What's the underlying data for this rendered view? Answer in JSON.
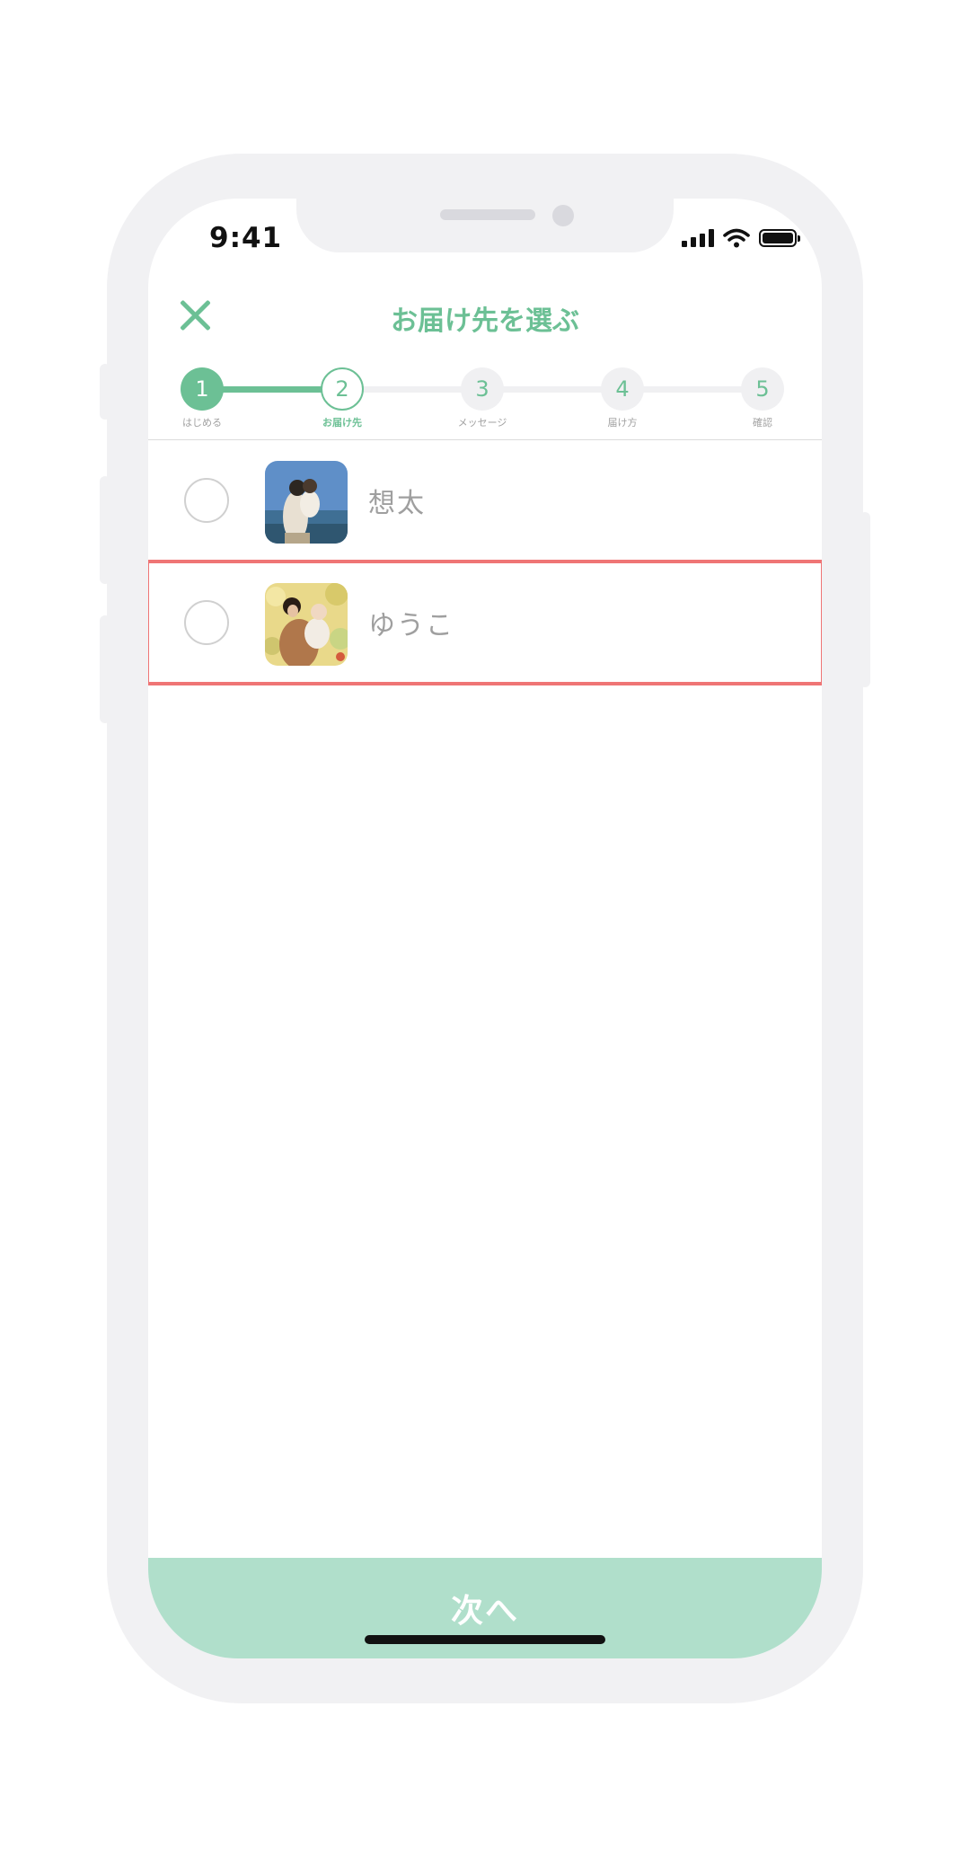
{
  "status_bar": {
    "time": "9:41"
  },
  "header": {
    "title": "お届け先を選ぶ"
  },
  "steps": [
    {
      "number": "1",
      "label": "はじめる",
      "state": "done"
    },
    {
      "number": "2",
      "label": "お届け先",
      "state": "current"
    },
    {
      "number": "3",
      "label": "メッセージ",
      "state": "upcoming"
    },
    {
      "number": "4",
      "label": "届け方",
      "state": "upcoming"
    },
    {
      "number": "5",
      "label": "確認",
      "state": "upcoming"
    }
  ],
  "recipients": [
    {
      "name": "想太",
      "selected": false
    },
    {
      "name": "ゆうこ",
      "selected": false
    }
  ],
  "footer": {
    "next_label": "次へ"
  },
  "colors": {
    "accent": "#6cc095",
    "button": "#b0dfcb",
    "highlight": "#ef7575"
  }
}
